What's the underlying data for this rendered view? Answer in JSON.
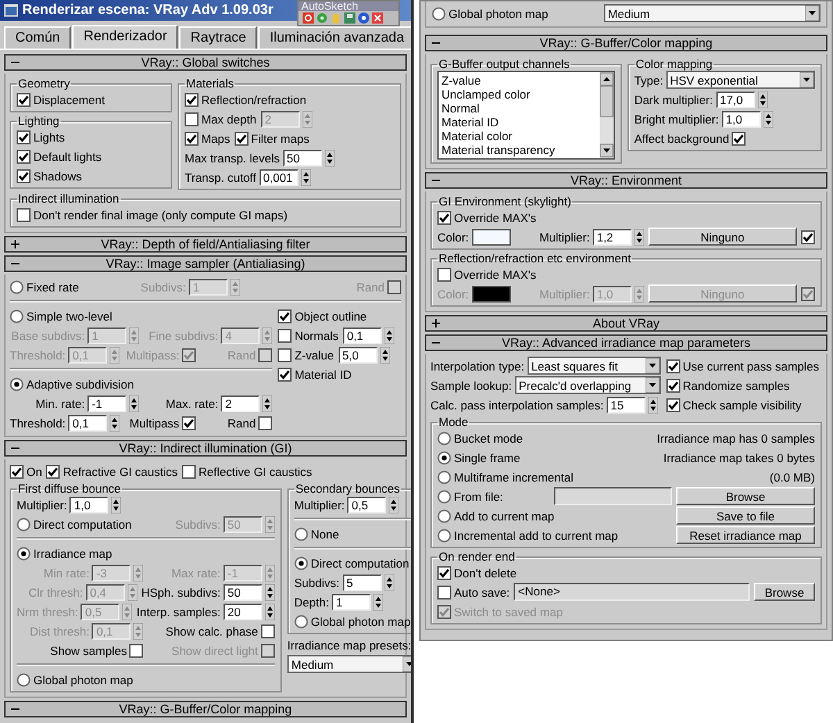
{
  "window": {
    "title": "Renderizar escena: VRay Adv 1.09.03r"
  },
  "overlay_toolbar": {
    "title": "AutoSketch"
  },
  "tabs": [
    {
      "label": "Común",
      "selected": false
    },
    {
      "label": "Renderizador",
      "selected": true
    },
    {
      "label": "Raytrace",
      "selected": false
    },
    {
      "label": "Iluminación avanzada",
      "selected": false
    }
  ],
  "left_panel": {
    "rollouts": [
      {
        "title": "VRay:: Global switches",
        "expanded": true,
        "body": [
          {
            "kind": "columns",
            "columns": [
              [
                {
                  "kind": "group",
                  "title": "Geometry",
                  "body": [
                    {
                      "kind": "row",
                      "items": [
                        {
                          "kind": "check",
                          "label": "Displacement",
                          "checked": true
                        }
                      ]
                    }
                  ]
                },
                {
                  "kind": "group",
                  "title": "Lighting",
                  "body": [
                    {
                      "kind": "row",
                      "items": [
                        {
                          "kind": "check",
                          "label": "Lights",
                          "checked": true
                        }
                      ]
                    },
                    {
                      "kind": "row",
                      "items": [
                        {
                          "kind": "check",
                          "label": "Default lights",
                          "checked": true
                        }
                      ]
                    },
                    {
                      "kind": "row",
                      "items": [
                        {
                          "kind": "check",
                          "label": "Shadows",
                          "checked": true
                        }
                      ]
                    }
                  ]
                }
              ],
              [
                {
                  "kind": "group",
                  "title": "Materials",
                  "body": [
                    {
                      "kind": "row",
                      "items": [
                        {
                          "kind": "check",
                          "label": "Reflection/refraction",
                          "checked": true
                        }
                      ]
                    },
                    {
                      "kind": "row",
                      "items": [
                        {
                          "kind": "check",
                          "label": "Max depth",
                          "checked": false,
                          "disabled": false
                        },
                        {
                          "kind": "spinner",
                          "value": "2",
                          "disabled": true
                        }
                      ]
                    },
                    {
                      "kind": "row",
                      "items": [
                        {
                          "kind": "check",
                          "label": "Maps",
                          "checked": true
                        },
                        {
                          "kind": "check",
                          "label": "Filter maps",
                          "checked": true
                        }
                      ]
                    },
                    {
                      "kind": "row",
                      "items": [
                        {
                          "kind": "spinner",
                          "label": "Max transp. levels",
                          "value": "50"
                        }
                      ]
                    },
                    {
                      "kind": "row",
                      "items": [
                        {
                          "kind": "spinner",
                          "label": "Transp. cutoff",
                          "value": "0,001"
                        }
                      ]
                    }
                  ]
                }
              ]
            ]
          },
          {
            "kind": "group",
            "title": "Indirect illumination",
            "body": [
              {
                "kind": "row",
                "items": [
                  {
                    "kind": "check",
                    "label": "Don't render final image (only compute GI maps)",
                    "checked": false
                  }
                ]
              }
            ]
          }
        ]
      },
      {
        "title": "VRay:: Depth of field/Antialiasing filter",
        "expanded": false
      },
      {
        "title": "VRay:: Image sampler (Antialiasing)",
        "expanded": true,
        "body": [
          {
            "kind": "row",
            "items": [
              {
                "kind": "radio",
                "label": "Fixed rate",
                "selected": false,
                "disabled": false
              },
              {
                "kind": "spinner",
                "label": "Subdivs:",
                "value": "1",
                "disabled": true
              },
              {
                "kind": "toggle",
                "label": "Rand",
                "checked": false,
                "disabled": true
              }
            ]
          },
          {
            "kind": "divider"
          },
          {
            "kind": "columns",
            "columns": [
              [
                {
                  "kind": "row",
                  "items": [
                    {
                      "kind": "radio",
                      "label": "Simple two-level",
                      "selected": false
                    }
                  ]
                },
                {
                  "kind": "row",
                  "items": [
                    {
                      "kind": "spinner",
                      "label": "Base subdivs:",
                      "value": "1",
                      "disabled": true
                    },
                    {
                      "kind": "spinner",
                      "label": "Fine subdivs:",
                      "value": "4",
                      "disabled": true
                    }
                  ]
                },
                {
                  "kind": "row",
                  "items": [
                    {
                      "kind": "spinner",
                      "label": "Threshold:",
                      "value": "0,1",
                      "disabled": true
                    },
                    {
                      "kind": "toggle",
                      "label": "Multipass:",
                      "checked": true,
                      "disabled": true
                    },
                    {
                      "kind": "toggle",
                      "label": "Rand",
                      "checked": false,
                      "disabled": true
                    }
                  ]
                },
                {
                  "kind": "divider"
                },
                {
                  "kind": "row",
                  "items": [
                    {
                      "kind": "radio",
                      "label": "Adaptive subdivision",
                      "selected": true
                    }
                  ]
                },
                {
                  "kind": "row",
                  "items": [
                    {
                      "kind": "spinner",
                      "label": "Min. rate:",
                      "value": "-1"
                    },
                    {
                      "kind": "spinner",
                      "label": "Max. rate:",
                      "value": "2"
                    }
                  ]
                },
                {
                  "kind": "row",
                  "items": [
                    {
                      "kind": "spinner",
                      "label": "Threshold:",
                      "value": "0,1"
                    },
                    {
                      "kind": "toggle",
                      "label": "Multipass",
                      "checked": true
                    },
                    {
                      "kind": "toggle",
                      "label": "Rand",
                      "checked": false
                    }
                  ]
                }
              ],
              [
                {
                  "kind": "row",
                  "items": [
                    {
                      "kind": "check",
                      "label": "Object outline",
                      "checked": true
                    }
                  ]
                },
                {
                  "kind": "row",
                  "items": [
                    {
                      "kind": "check",
                      "label": "Normals",
                      "checked": false
                    },
                    {
                      "kind": "spinner",
                      "value": "0,1"
                    }
                  ]
                },
                {
                  "kind": "row",
                  "items": [
                    {
                      "kind": "check",
                      "label": "Z-value",
                      "checked": false
                    },
                    {
                      "kind": "spinner",
                      "value": "5,0"
                    }
                  ]
                },
                {
                  "kind": "row",
                  "items": [
                    {
                      "kind": "check",
                      "label": "Material ID",
                      "checked": true
                    }
                  ]
                }
              ]
            ]
          }
        ]
      },
      {
        "title": "VRay:: Indirect illumination (GI)",
        "expanded": true,
        "body": [
          {
            "kind": "row",
            "items": [
              {
                "kind": "check",
                "label": "On",
                "checked": true
              },
              {
                "kind": "check",
                "label": "Refractive GI caustics",
                "checked": true
              },
              {
                "kind": "check",
                "label": "Reflective GI caustics",
                "checked": false
              }
            ]
          },
          {
            "kind": "columns",
            "columns": [
              [
                {
                  "kind": "group",
                  "title": "First diffuse bounce",
                  "body": [
                    {
                      "kind": "row",
                      "items": [
                        {
                          "kind": "spinner",
                          "label": "Multiplier:",
                          "value": "1,0"
                        }
                      ]
                    },
                    {
                      "kind": "row",
                      "items": [
                        {
                          "kind": "radio",
                          "label": "Direct computation",
                          "selected": false,
                          "disabled": false
                        },
                        {
                          "kind": "spinner",
                          "label": "Subdivs:",
                          "value": "50",
                          "disabled": true
                        }
                      ]
                    },
                    {
                      "kind": "divider"
                    },
                    {
                      "kind": "row",
                      "items": [
                        {
                          "kind": "radio",
                          "label": "Irradiance map",
                          "selected": true
                        }
                      ]
                    },
                    {
                      "kind": "row",
                      "items": [
                        {
                          "kind": "spinner",
                          "label": "Min rate:",
                          "value": "-3",
                          "disabled": true
                        },
                        {
                          "kind": "spinner",
                          "label": "Max rate:",
                          "value": "-1",
                          "disabled": true
                        }
                      ]
                    },
                    {
                      "kind": "row",
                      "items": [
                        {
                          "kind": "spinner",
                          "label": "Clr thresh:",
                          "value": "0,4",
                          "disabled": true
                        },
                        {
                          "kind": "spinner",
                          "label": "HSph. subdivs:",
                          "value": "50",
                          "disabled": false
                        }
                      ]
                    },
                    {
                      "kind": "row",
                      "items": [
                        {
                          "kind": "spinner",
                          "label": "Nrm thresh:",
                          "value": "0,5",
                          "disabled": true
                        },
                        {
                          "kind": "spinner",
                          "label": "Interp. samples:",
                          "value": "20",
                          "disabled": false
                        }
                      ]
                    },
                    {
                      "kind": "row",
                      "items": [
                        {
                          "kind": "spinner",
                          "label": "Dist thresh:",
                          "value": "0,1",
                          "disabled": true
                        },
                        {
                          "kind": "toggle",
                          "label": "Show calc. phase",
                          "checked": false,
                          "disabled": false
                        }
                      ]
                    },
                    {
                      "kind": "row",
                      "items": [
                        {
                          "kind": "toggle",
                          "label": "Show samples",
                          "checked": false,
                          "disabled": false
                        },
                        {
                          "kind": "toggle",
                          "label": "Show direct light",
                          "checked": false,
                          "disabled": true
                        }
                      ]
                    },
                    {
                      "kind": "divider"
                    },
                    {
                      "kind": "row",
                      "items": [
                        {
                          "kind": "radio",
                          "label": "Global photon map",
                          "selected": false
                        }
                      ]
                    }
                  ]
                }
              ],
              [
                {
                  "kind": "group",
                  "title": "Secondary bounces",
                  "body": [
                    {
                      "kind": "row",
                      "items": [
                        {
                          "kind": "spinner",
                          "label": "Multiplier:",
                          "value": "0,5"
                        }
                      ]
                    },
                    {
                      "kind": "divider"
                    },
                    {
                      "kind": "row",
                      "items": [
                        {
                          "kind": "radio",
                          "label": "None",
                          "selected": false
                        }
                      ]
                    },
                    {
                      "kind": "divider"
                    },
                    {
                      "kind": "row",
                      "items": [
                        {
                          "kind": "radio",
                          "label": "Direct computation",
                          "selected": true
                        }
                      ]
                    },
                    {
                      "kind": "row",
                      "items": [
                        {
                          "kind": "spinner",
                          "label": "Subdivs:",
                          "value": "5"
                        }
                      ]
                    },
                    {
                      "kind": "row",
                      "items": [
                        {
                          "kind": "spinner",
                          "label": "Depth:",
                          "value": "1"
                        }
                      ]
                    },
                    {
                      "kind": "row",
                      "items": [
                        {
                          "kind": "radio",
                          "label": "Global photon map",
                          "selected": false
                        }
                      ]
                    }
                  ]
                },
                {
                  "kind": "row",
                  "items": [
                    {
                      "kind": "text",
                      "text": "Irradiance map presets:"
                    }
                  ]
                },
                {
                  "kind": "row",
                  "items": [
                    {
                      "kind": "dropdown",
                      "value": "Medium"
                    }
                  ]
                }
              ]
            ]
          }
        ]
      },
      {
        "title": "VRay:: G-Buffer/Color mapping",
        "expanded": true
      }
    ]
  },
  "right_panel": {
    "top_row": {
      "items": [
        {
          "kind": "radio",
          "label": "Global photon map",
          "selected": false
        },
        {
          "kind": "dropdown",
          "value": "Medium"
        }
      ]
    },
    "rollouts": [
      {
        "title": "VRay:: G-Buffer/Color mapping",
        "expanded": true,
        "body": [
          {
            "kind": "columns",
            "columns": [
              [
                {
                  "kind": "group",
                  "title": "G-Buffer output channels",
                  "body": [
                    {
                      "kind": "row",
                      "items": [
                        {
                          "kind": "listbox",
                          "items": [
                            "Z-value",
                            "Unclamped color",
                            "Normal",
                            "Material ID",
                            "Material color",
                            "Material transparency"
                          ]
                        }
                      ]
                    }
                  ]
                }
              ],
              [
                {
                  "kind": "group",
                  "title": "Color mapping",
                  "body": [
                    {
                      "kind": "row",
                      "items": [
                        {
                          "kind": "dropdown",
                          "label": "Type:",
                          "value": "HSV exponential"
                        }
                      ]
                    },
                    {
                      "kind": "row",
                      "items": [
                        {
                          "kind": "spinner",
                          "label": "Dark multiplier:",
                          "value": "17,0"
                        }
                      ]
                    },
                    {
                      "kind": "row",
                      "items": [
                        {
                          "kind": "spinner",
                          "label": "Bright multiplier:",
                          "value": "1,0"
                        }
                      ]
                    },
                    {
                      "kind": "row",
                      "items": [
                        {
                          "kind": "toggle",
                          "label": "Affect background",
                          "checked": true
                        }
                      ]
                    }
                  ]
                }
              ]
            ]
          }
        ]
      },
      {
        "title": "VRay:: Environment",
        "expanded": true,
        "body": [
          {
            "kind": "group",
            "title": "GI Environment (skylight)",
            "body": [
              {
                "kind": "row",
                "items": [
                  {
                    "kind": "check",
                    "label": "Override MAX's",
                    "checked": true
                  }
                ]
              },
              {
                "kind": "row",
                "items": [
                  {
                    "kind": "color",
                    "label": "Color:",
                    "color": "#f4f8ff",
                    "disabled": false
                  },
                  {
                    "kind": "spinner",
                    "label": "Multiplier:",
                    "value": "1,2",
                    "disabled": false
                  },
                  {
                    "kind": "button",
                    "label": "Ninguno",
                    "disabled": false
                  },
                  {
                    "kind": "check",
                    "checked": true,
                    "disabled": false
                  }
                ]
              }
            ]
          },
          {
            "kind": "group",
            "title": "Reflection/refraction etc environment",
            "body": [
              {
                "kind": "row",
                "items": [
                  {
                    "kind": "check",
                    "label": "Override MAX's",
                    "checked": false
                  }
                ]
              },
              {
                "kind": "row",
                "items": [
                  {
                    "kind": "color",
                    "label": "Color:",
                    "color": "#000000",
                    "disabled": true
                  },
                  {
                    "kind": "spinner",
                    "label": "Multiplier:",
                    "value": "1,0",
                    "disabled": true
                  },
                  {
                    "kind": "button",
                    "label": "Ninguno",
                    "disabled": true
                  },
                  {
                    "kind": "check",
                    "checked": true,
                    "disabled": true
                  }
                ]
              }
            ]
          }
        ]
      },
      {
        "title": "About VRay",
        "expanded": false
      },
      {
        "title": "VRay:: Advanced irradiance map parameters",
        "expanded": true,
        "body": [
          {
            "kind": "columns",
            "columns": [
              [
                {
                  "kind": "row",
                  "items": [
                    {
                      "kind": "dropdown",
                      "label": "Interpolation type:",
                      "value": "Least squares fit"
                    }
                  ]
                },
                {
                  "kind": "row",
                  "items": [
                    {
                      "kind": "dropdown",
                      "label": "Sample lookup:",
                      "value": "Precalc'd overlapping"
                    }
                  ]
                },
                {
                  "kind": "row",
                  "items": [
                    {
                      "kind": "spinner",
                      "label": "Calc. pass interpolation samples:",
                      "value": "15"
                    }
                  ]
                }
              ],
              [
                {
                  "kind": "row",
                  "items": [
                    {
                      "kind": "check",
                      "label": "Use current pass samples",
                      "checked": true
                    }
                  ]
                },
                {
                  "kind": "row",
                  "items": [
                    {
                      "kind": "check",
                      "label": "Randomize samples",
                      "checked": true
                    }
                  ]
                },
                {
                  "kind": "row",
                  "items": [
                    {
                      "kind": "check",
                      "label": "Check sample visibility",
                      "checked": true
                    }
                  ]
                }
              ]
            ]
          },
          {
            "kind": "group",
            "title": "Mode",
            "body": [
              {
                "kind": "columns",
                "columns": [
                  [
                    {
                      "kind": "row",
                      "items": [
                        {
                          "kind": "radio",
                          "label": "Bucket mode",
                          "selected": false
                        }
                      ]
                    },
                    {
                      "kind": "row",
                      "items": [
                        {
                          "kind": "radio",
                          "label": "Single frame",
                          "selected": true
                        }
                      ]
                    },
                    {
                      "kind": "row",
                      "items": [
                        {
                          "kind": "radio",
                          "label": "Multiframe incremental",
                          "selected": false
                        }
                      ]
                    }
                  ],
                  [
                    {
                      "kind": "row",
                      "items": [
                        {
                          "kind": "text",
                          "text": "Irradiance map has 0 samples"
                        }
                      ]
                    },
                    {
                      "kind": "row",
                      "items": [
                        {
                          "kind": "text",
                          "text": "Irradiance map takes 0 bytes"
                        }
                      ]
                    },
                    {
                      "kind": "row",
                      "items": [
                        {
                          "kind": "text",
                          "text": "(0.0 MB)"
                        }
                      ]
                    }
                  ]
                ]
              },
              {
                "kind": "row",
                "items": [
                  {
                    "kind": "radio",
                    "label": "From file:",
                    "selected": false
                  },
                  {
                    "kind": "field"
                  },
                  {
                    "kind": "button",
                    "label": "Browse"
                  }
                ]
              },
              {
                "kind": "row",
                "items": [
                  {
                    "kind": "radio",
                    "label": "Add to current map",
                    "selected": false
                  },
                  {
                    "kind": "button",
                    "label": "Save to file"
                  }
                ]
              },
              {
                "kind": "row",
                "items": [
                  {
                    "kind": "radio",
                    "label": "Incremental add to current map",
                    "selected": false
                  },
                  {
                    "kind": "button",
                    "label": "Reset irradiance map"
                  }
                ]
              }
            ]
          },
          {
            "kind": "group",
            "title": "On render end",
            "body": [
              {
                "kind": "row",
                "items": [
                  {
                    "kind": "check",
                    "label": "Don't delete",
                    "checked": true
                  }
                ]
              },
              {
                "kind": "row",
                "items": [
                  {
                    "kind": "check",
                    "label": "Auto save:",
                    "checked": false
                  },
                  {
                    "kind": "field",
                    "value": "<None>"
                  },
                  {
                    "kind": "button",
                    "label": "Browse"
                  }
                ]
              },
              {
                "kind": "row",
                "items": [
                  {
                    "kind": "check",
                    "label": "Switch to saved map",
                    "checked": true,
                    "disabled": true
                  }
                ]
              }
            ]
          }
        ]
      }
    ]
  }
}
